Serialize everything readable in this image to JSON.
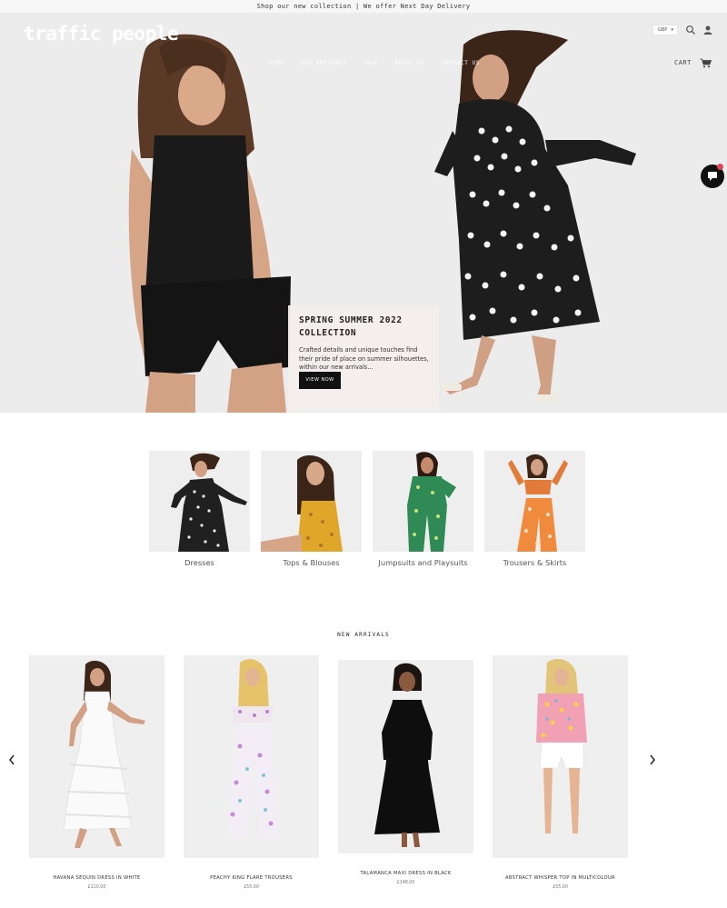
{
  "announcement": "Shop our new collection | We offer Next Day Delivery",
  "brand": {
    "logo": "traffic people"
  },
  "nav": [
    "HOME",
    "NEW ARRIVALS",
    "SALE",
    "ABOUT US",
    "CONTACT US"
  ],
  "header": {
    "currency": "GBP",
    "cart_label": "CART",
    "icons": [
      "search-icon",
      "account-icon",
      "cart-icon"
    ]
  },
  "hero": {
    "title": "SPRING SUMMER 2022 COLLECTION",
    "text": "Crafted details and unique touches find their pride of place on summer silhouettes, within our new arrivals...",
    "button": "VIEW NOW"
  },
  "categories": [
    {
      "label": "Dresses"
    },
    {
      "label": "Tops & Blouses"
    },
    {
      "label": "Jumpsuits and Playsuits"
    },
    {
      "label": "Trousers & Skirts"
    }
  ],
  "new_arrivals": {
    "title": "NEW ARRIVALS",
    "products": [
      {
        "name": "HAVANA SEQUIN DRESS IN WHITE",
        "price": "£110.00"
      },
      {
        "name": "PEACHY KING FLARE TROUSERS",
        "price": "£55.00"
      },
      {
        "name": "TALAMANCA MAXI DRESS IN BLACK",
        "price": "£148.00"
      },
      {
        "name": "ABSTRACT WHISPER TOP IN MULTICOLOUR",
        "price": "£55.00"
      }
    ]
  },
  "colors": {
    "accent": "#111111",
    "hero_bg": "#ececec",
    "chat_badge": "#e8415a"
  }
}
